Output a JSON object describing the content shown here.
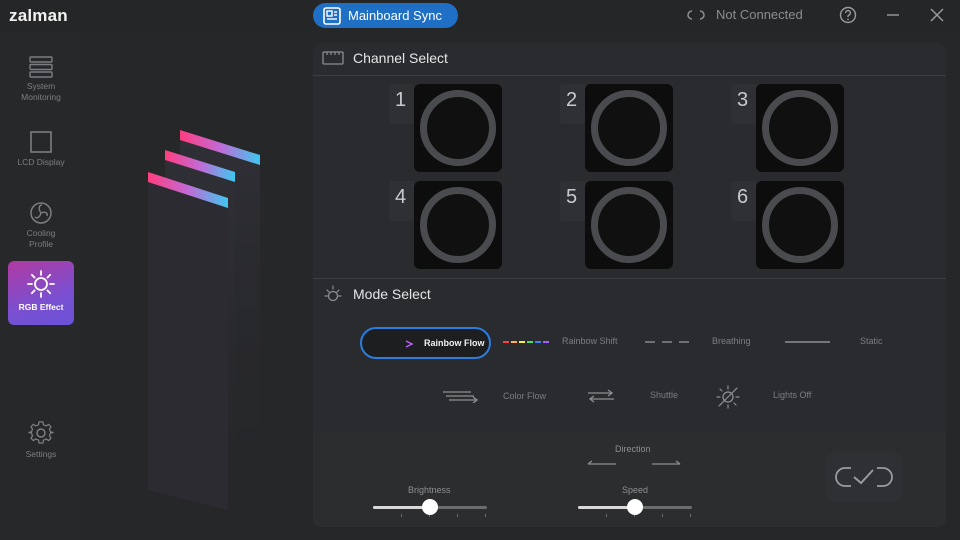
{
  "app": {
    "logo": "zalman",
    "sync_label": "Mainboard Sync",
    "connection_status": "Not Connected"
  },
  "sidebar": {
    "items": [
      {
        "label": "System\nMonitoring",
        "icon": "server-icon"
      },
      {
        "label": "LCD Display",
        "icon": "square-icon"
      },
      {
        "label": "Cooling\nProfile",
        "icon": "fan-icon"
      },
      {
        "label": "RGB Effect",
        "icon": "sun-icon"
      },
      {
        "label": "Settings",
        "icon": "gear-icon"
      }
    ]
  },
  "channel_section": {
    "title": "Channel Select",
    "channels": [
      "1",
      "2",
      "3",
      "4",
      "5",
      "6"
    ]
  },
  "mode_section": {
    "title": "Mode Select",
    "modes": [
      {
        "label": "Rainbow Flow",
        "icon": "rainbow-flow-icon",
        "selected": true
      },
      {
        "label": "Rainbow Shift",
        "icon": "rainbow-shift-icon"
      },
      {
        "label": "Breathing",
        "icon": "breathing-icon"
      },
      {
        "label": "Static",
        "icon": "static-icon"
      },
      {
        "label": "Color Flow",
        "icon": "color-flow-icon"
      },
      {
        "label": "Shuttle",
        "icon": "shuttle-icon"
      },
      {
        "label": "Lights Off",
        "icon": "lights-off-icon"
      }
    ]
  },
  "controls": {
    "direction_label": "Direction",
    "brightness_label": "Brightness",
    "speed_label": "Speed",
    "brightness_level": 0.5,
    "speed_level": 0.5
  },
  "colors": {
    "accent": "#1f6fc5",
    "active_gradient_start": "#b13aa1",
    "active_gradient_end": "#6a52d8"
  }
}
